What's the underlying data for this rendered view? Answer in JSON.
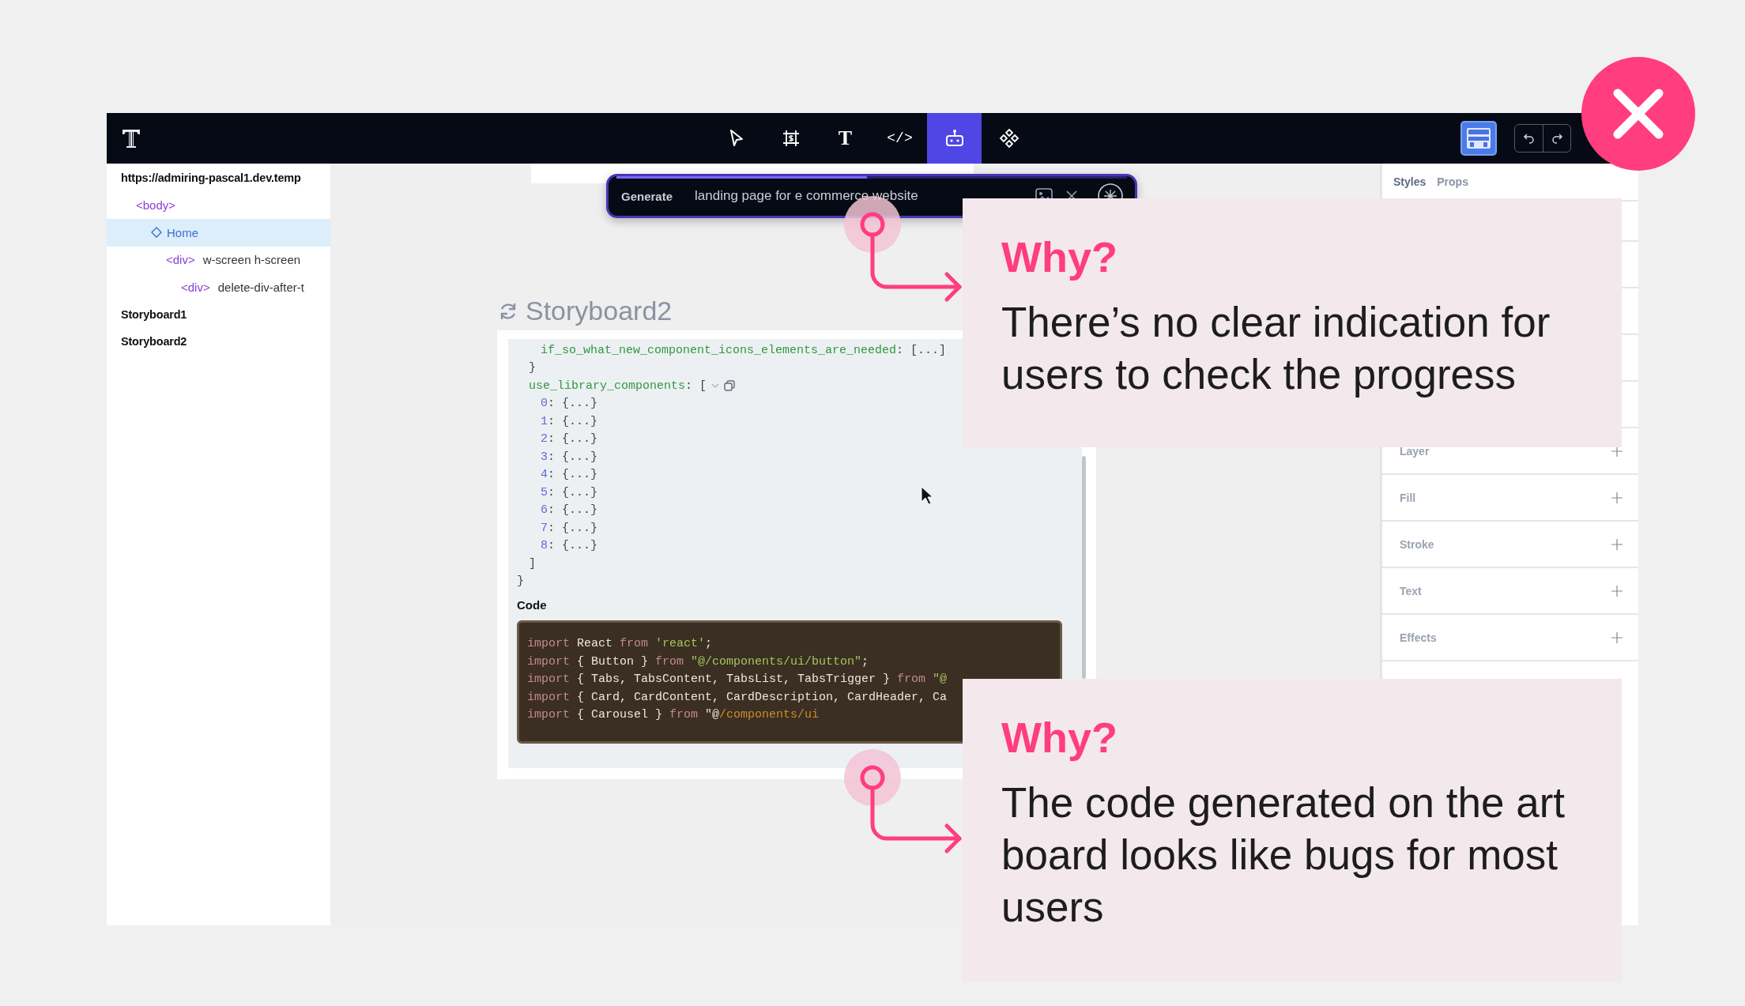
{
  "toolbar": {
    "tools": [
      {
        "kind": "pointer",
        "selected": false
      },
      {
        "kind": "frame",
        "selected": false
      },
      {
        "kind": "text",
        "label": "T",
        "selected": false
      },
      {
        "kind": "code",
        "label": "</>",
        "selected": false
      },
      {
        "kind": "robot",
        "selected": true
      },
      {
        "kind": "components",
        "selected": false
      }
    ]
  },
  "layers": {
    "items": [
      {
        "kind": "heading",
        "label": "https://admiring-pascal1.dev.temp",
        "selected": false,
        "children": [
          {
            "kind": "tag",
            "tag": "<body>",
            "selected": false,
            "children": [
              {
                "kind": "component",
                "label": "Home",
                "selected": true,
                "children": [
                  {
                    "kind": "tag",
                    "tag": "<div>",
                    "label": "w-screen h-screen",
                    "selected": false,
                    "children": [
                      {
                        "kind": "tag",
                        "tag": "<div>",
                        "label": "delete-div-after-t",
                        "selected": false
                      }
                    ]
                  }
                ]
              }
            ]
          }
        ]
      },
      {
        "kind": "heading",
        "label": "Storyboard1",
        "selected": false
      },
      {
        "kind": "heading",
        "label": "Storyboard2",
        "selected": false
      }
    ]
  },
  "generate_bar": {
    "label": "Generate",
    "prompt": "landing page for e commerce website",
    "level": 0.49
  },
  "storyboard": {
    "title": "Storyboard2",
    "json_view": {
      "close": "}",
      "children": [
        {
          "close": "}",
          "children": [
            {
              "kind": "key",
              "key": "if_so_what_new_component_icons_elements_are_needed",
              "value": ": [...]"
            }
          ]
        },
        {
          "kind": "key",
          "key": "use_library_components",
          "open": ": [",
          "close": "]",
          "expandable": true,
          "children": [
            {
              "kind": "index",
              "key": "0",
              "value": ": {...}"
            },
            {
              "kind": "index",
              "key": "1",
              "value": ": {...}"
            },
            {
              "kind": "index",
              "key": "2",
              "value": ": {...}"
            },
            {
              "kind": "index",
              "key": "3",
              "value": ": {...}"
            },
            {
              "kind": "index",
              "key": "4",
              "value": ": {...}"
            },
            {
              "kind": "index",
              "key": "5",
              "value": ": {...}"
            },
            {
              "kind": "index",
              "key": "6",
              "value": ": {...}"
            },
            {
              "kind": "index",
              "key": "7",
              "value": ": {...}"
            },
            {
              "kind": "index",
              "key": "8",
              "value": ": {...}"
            }
          ]
        }
      ]
    },
    "code_label": "Code",
    "code_lines": [
      [
        {
          "kind": "keyword",
          "text": "import"
        },
        {
          "kind": "plain",
          "text": " React "
        },
        {
          "kind": "keyword",
          "text": "from"
        },
        {
          "kind": "string",
          "text": " 'react'"
        },
        {
          "kind": "plain",
          "text": ";"
        }
      ],
      [
        {
          "kind": "keyword",
          "text": "import"
        },
        {
          "kind": "plain",
          "text": " { Button } "
        },
        {
          "kind": "keyword",
          "text": "from"
        },
        {
          "kind": "string",
          "text": " \"@/components/ui/button\""
        },
        {
          "kind": "plain",
          "text": ";"
        }
      ],
      [
        {
          "kind": "keyword",
          "text": "import"
        },
        {
          "kind": "plain",
          "text": " { Tabs, TabsContent, TabsList, TabsTrigger } "
        },
        {
          "kind": "keyword",
          "text": "from"
        },
        {
          "kind": "string",
          "text": " \"@"
        }
      ],
      [
        {
          "kind": "keyword",
          "text": "import"
        },
        {
          "kind": "plain",
          "text": " { Card, CardContent, CardDescription, CardHeader, Ca"
        }
      ],
      [
        {
          "kind": "keyword",
          "text": "import"
        },
        {
          "kind": "plain",
          "text": " { Carousel } "
        },
        {
          "kind": "keyword",
          "text": "from"
        },
        {
          "kind": "plain",
          "text": " \"@"
        },
        {
          "kind": "path",
          "text": "/components/ui"
        }
      ]
    ]
  },
  "inspector": {
    "tabs": [
      {
        "label": "Styles",
        "selected": true
      },
      {
        "label": "Props",
        "selected": false
      }
    ],
    "sections": [
      "Layer",
      "Fill",
      "Stroke",
      "Text",
      "Effects"
    ]
  },
  "annotations": [
    {
      "heading": "Why?",
      "text": "There’s no clear indication for users to check the progress"
    },
    {
      "heading": "Why?",
      "text": "The code generated on the art board looks like bugs for most users"
    }
  ]
}
